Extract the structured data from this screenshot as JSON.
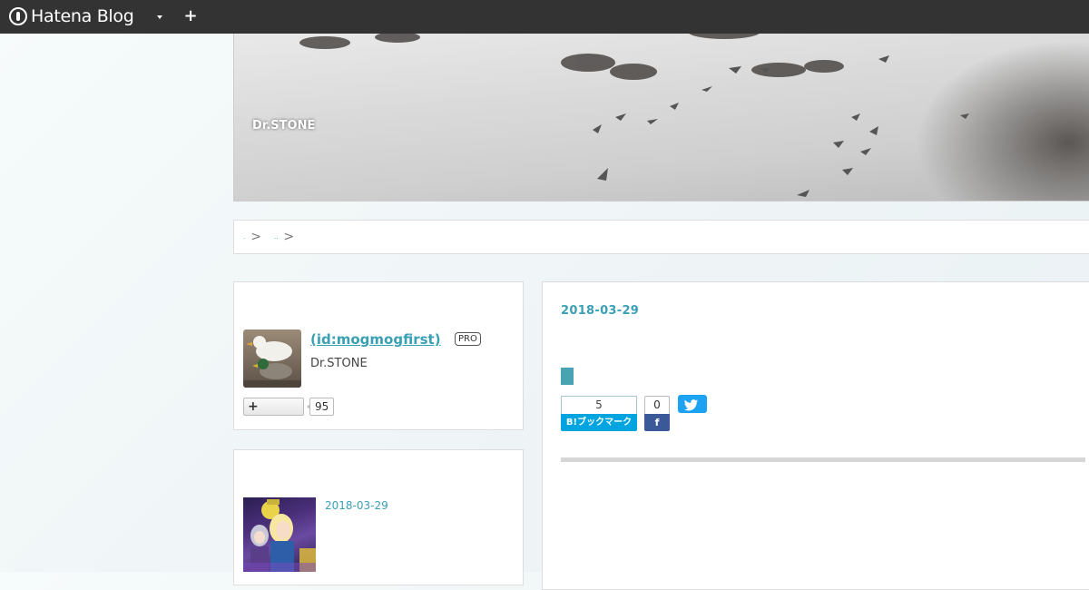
{
  "topbar": {
    "logo_text": "Hatena Blog",
    "icons": [
      "hatena-logo-icon",
      "chevron-down-icon",
      "plus-icon"
    ],
    "plus_glyph": "+"
  },
  "header": {
    "blog_title": "Dr.STONE"
  },
  "breadcrumb": {
    "items": [
      {
        "label": ".",
        "separator": ">"
      },
      {
        "label": "..",
        "separator": ">"
      }
    ]
  },
  "profile": {
    "name": " (id:mogmogfirst)",
    "badge": "PRO",
    "subtitle": "Dr.STONE",
    "follow_glyph": "+",
    "follow_count": "95"
  },
  "recent": {
    "date": "2018-03-29"
  },
  "entry": {
    "date": "2018-03-29",
    "hatena_bookmark": {
      "count": "5",
      "label": "B!ブックマーク"
    },
    "facebook": {
      "count": "0",
      "glyph": "f"
    }
  },
  "colors": {
    "accent": "#3aa0b4",
    "topbar": "#333333",
    "hatena_blue": "#00a4de",
    "facebook": "#3b5998",
    "twitter": "#1da1f2"
  }
}
